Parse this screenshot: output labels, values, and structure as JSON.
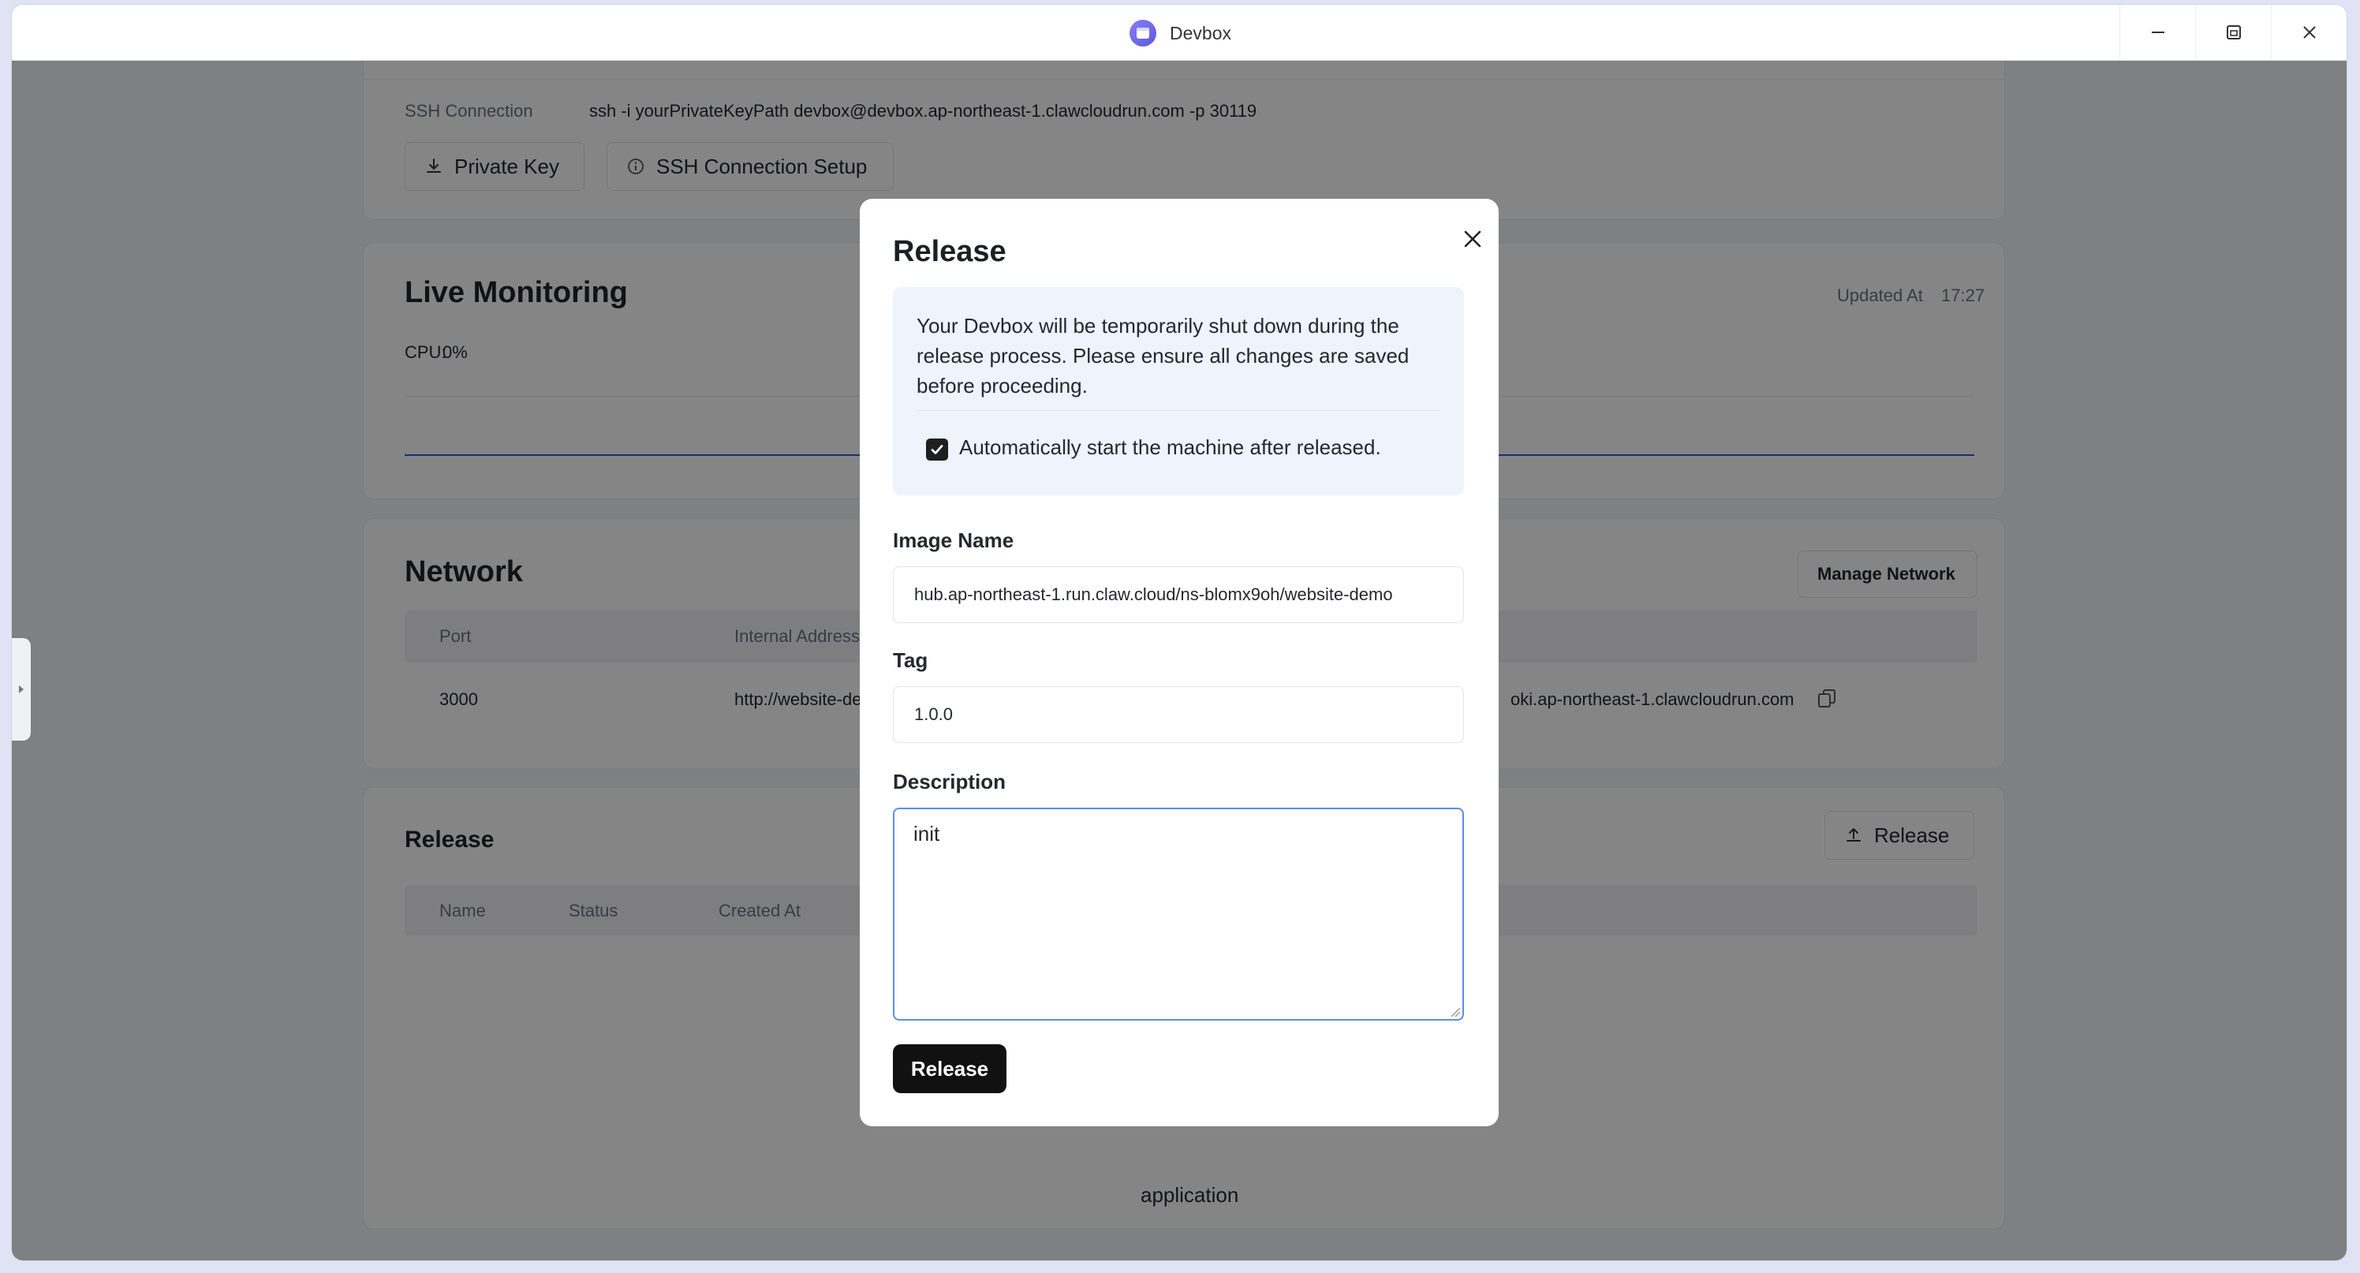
{
  "window": {
    "title": "Devbox"
  },
  "ssh": {
    "label": "SSH Connection",
    "command": "ssh -i yourPrivateKeyPath devbox@devbox.ap-northeast-1.clawcloudrun.com -p 30119",
    "private_key_button": "Private Key",
    "setup_button": "SSH Connection Setup"
  },
  "monitoring": {
    "title": "Live Monitoring",
    "updated_label": "Updated At",
    "updated_time": "17:27",
    "cpu_label": "CPU:",
    "cpu_value": "0%"
  },
  "network": {
    "title": "Network",
    "manage_button": "Manage Network",
    "columns": {
      "port": "Port",
      "internal": "Internal Address"
    },
    "row": {
      "port": "3000",
      "internal_address": "http://website-de",
      "public_address_tail": "oki.ap-northeast-1.clawcloudrun.com"
    }
  },
  "release_section": {
    "title": "Release",
    "release_button": "Release",
    "columns": {
      "name": "Name",
      "status": "Status",
      "created_at": "Created At"
    },
    "empty_text": "application"
  },
  "modal": {
    "title": "Release",
    "notice": "Your Devbox will be temporarily shut down during the release process. Please ensure all changes are saved before proceeding.",
    "auto_start_label": "Automatically start the machine after released.",
    "auto_start_checked": true,
    "image_name_label": "Image Name",
    "image_name_value": "hub.ap-northeast-1.run.claw.cloud/ns-blomx9oh/website-demo",
    "tag_label": "Tag",
    "tag_value": "1.0.0",
    "description_label": "Description",
    "description_value": "init",
    "submit_label": "Release"
  },
  "colors": {
    "overlay": "#000000",
    "chart_line": "#3b5bdb",
    "notice_bg": "#eef3fc",
    "primary_button": "#111111"
  }
}
